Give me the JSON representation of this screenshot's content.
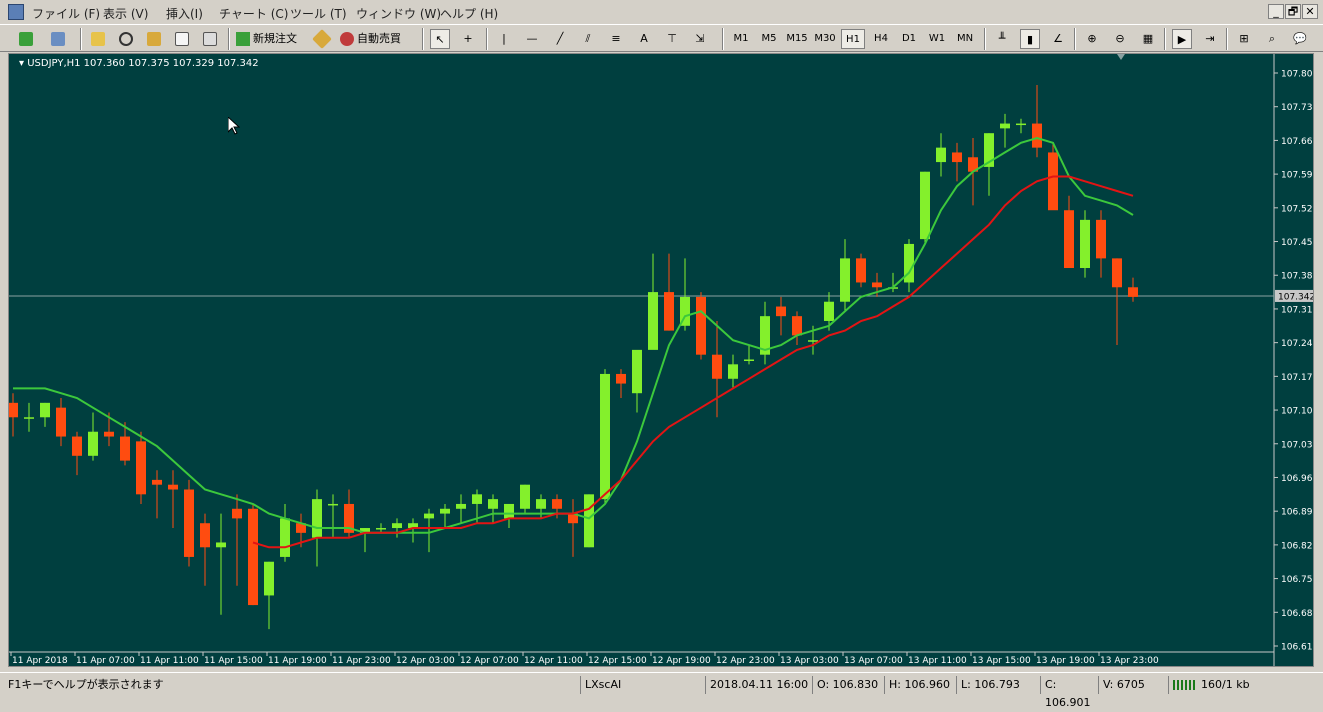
{
  "menu": {
    "items": [
      "ファイル (F)",
      "表示 (V)",
      "挿入(I)",
      "チャート (C)",
      "ツール (T)",
      "ウィンドウ (W)",
      "ヘルプ (H)"
    ],
    "window_controls": [
      "_",
      "🗗",
      "✕"
    ]
  },
  "toolbar": {
    "new_order_label": "新規注文",
    "auto_trade_label": "自動売買",
    "text_tool": "A",
    "timeframes": [
      "M1",
      "M5",
      "M15",
      "M30",
      "H1",
      "H4",
      "D1",
      "W1",
      "MN"
    ],
    "active_timeframe": "H1"
  },
  "chart": {
    "header": "USDJPY,H1  107.360 107.375 107.329 107.342",
    "current_price_label": "107.342",
    "colors": {
      "background": "#003f3f",
      "bull": "#84f02c",
      "bear": "#ff4c10",
      "ma_fast": "#3cc83c",
      "ma_slow": "#e31414",
      "price_line": "#8aa2a2"
    }
  },
  "chart_data": {
    "type": "candlestick",
    "symbol": "USDJPY",
    "timeframe": "H1",
    "header_ohlc": {
      "open": 107.36,
      "high": 107.375,
      "low": 107.329,
      "close": 107.342
    },
    "ylim": [
      106.615,
      107.805
    ],
    "y_ticks": [
      "107.805",
      "107.735",
      "107.665",
      "107.595",
      "107.525",
      "107.455",
      "107.385",
      "107.315",
      "107.245",
      "107.175",
      "107.105",
      "107.035",
      "106.965",
      "106.895",
      "106.825",
      "106.755",
      "106.685",
      "106.615"
    ],
    "x_ticks": [
      "11 Apr 2018",
      "11 Apr 07:00",
      "11 Apr 11:00",
      "11 Apr 15:00",
      "11 Apr 19:00",
      "11 Apr 23:00",
      "12 Apr 03:00",
      "12 Apr 07:00",
      "12 Apr 11:00",
      "12 Apr 15:00",
      "12 Apr 19:00",
      "12 Apr 23:00",
      "13 Apr 03:00",
      "13 Apr 07:00",
      "13 Apr 11:00",
      "13 Apr 15:00",
      "13 Apr 19:00",
      "13 Apr 23:00"
    ],
    "candles": [
      [
        107.12,
        107.14,
        107.05,
        107.09
      ],
      [
        107.09,
        107.12,
        107.06,
        107.09
      ],
      [
        107.09,
        107.12,
        107.07,
        107.12
      ],
      [
        107.11,
        107.13,
        107.03,
        107.05
      ],
      [
        107.05,
        107.06,
        106.97,
        107.01
      ],
      [
        107.01,
        107.1,
        107.0,
        107.06
      ],
      [
        107.06,
        107.1,
        107.03,
        107.05
      ],
      [
        107.05,
        107.08,
        106.99,
        107.0
      ],
      [
        107.04,
        107.06,
        106.91,
        106.93
      ],
      [
        106.96,
        106.98,
        106.88,
        106.95
      ],
      [
        106.95,
        106.98,
        106.86,
        106.94
      ],
      [
        106.94,
        106.96,
        106.78,
        106.8
      ],
      [
        106.87,
        106.89,
        106.74,
        106.82
      ],
      [
        106.82,
        106.89,
        106.68,
        106.83
      ],
      [
        106.9,
        106.93,
        106.74,
        106.88
      ],
      [
        106.9,
        106.91,
        106.7,
        106.7
      ],
      [
        106.72,
        106.79,
        106.65,
        106.79
      ],
      [
        106.8,
        106.91,
        106.79,
        106.88
      ],
      [
        106.87,
        106.89,
        106.82,
        106.85
      ],
      [
        106.84,
        106.94,
        106.78,
        106.92
      ],
      [
        106.91,
        106.93,
        106.84,
        106.91
      ],
      [
        106.91,
        106.94,
        106.84,
        106.85
      ],
      [
        106.85,
        106.86,
        106.81,
        106.86
      ],
      [
        106.86,
        106.87,
        106.85,
        106.86
      ],
      [
        106.86,
        106.88,
        106.84,
        106.87
      ],
      [
        106.86,
        106.88,
        106.83,
        106.87
      ],
      [
        106.88,
        106.9,
        106.81,
        106.89
      ],
      [
        106.89,
        106.91,
        106.86,
        106.9
      ],
      [
        106.9,
        106.93,
        106.87,
        106.91
      ],
      [
        106.91,
        106.94,
        106.87,
        106.93
      ],
      [
        106.9,
        106.93,
        106.87,
        106.92
      ],
      [
        106.88,
        106.91,
        106.86,
        106.91
      ],
      [
        106.9,
        106.95,
        106.89,
        106.95
      ],
      [
        106.9,
        106.93,
        106.88,
        106.92
      ],
      [
        106.92,
        106.93,
        106.88,
        106.9
      ],
      [
        106.89,
        106.92,
        106.8,
        106.87
      ],
      [
        106.82,
        106.93,
        106.82,
        106.93
      ],
      [
        106.92,
        107.19,
        106.91,
        107.18
      ],
      [
        107.18,
        107.19,
        107.13,
        107.16
      ],
      [
        107.14,
        107.22,
        107.1,
        107.23
      ],
      [
        107.23,
        107.43,
        107.24,
        107.35
      ],
      [
        107.35,
        107.43,
        107.27,
        107.27
      ],
      [
        107.28,
        107.42,
        107.27,
        107.34
      ],
      [
        107.34,
        107.35,
        107.21,
        107.22
      ],
      [
        107.22,
        107.29,
        107.09,
        107.17
      ],
      [
        107.17,
        107.22,
        107.15,
        107.2
      ],
      [
        107.21,
        107.24,
        107.2,
        107.21
      ],
      [
        107.22,
        107.33,
        107.2,
        107.3
      ],
      [
        107.32,
        107.34,
        107.26,
        107.3
      ],
      [
        107.3,
        107.31,
        107.24,
        107.26
      ],
      [
        107.25,
        107.28,
        107.22,
        107.25
      ],
      [
        107.29,
        107.35,
        107.27,
        107.33
      ],
      [
        107.33,
        107.46,
        107.31,
        107.42
      ],
      [
        107.42,
        107.43,
        107.36,
        107.37
      ],
      [
        107.37,
        107.39,
        107.34,
        107.36
      ],
      [
        107.36,
        107.39,
        107.35,
        107.36
      ],
      [
        107.37,
        107.46,
        107.35,
        107.45
      ],
      [
        107.46,
        107.6,
        107.45,
        107.6
      ],
      [
        107.62,
        107.68,
        107.59,
        107.65
      ],
      [
        107.64,
        107.66,
        107.58,
        107.62
      ],
      [
        107.63,
        107.67,
        107.53,
        107.6
      ],
      [
        107.61,
        107.68,
        107.55,
        107.68
      ],
      [
        107.69,
        107.72,
        107.65,
        107.7
      ],
      [
        107.7,
        107.71,
        107.68,
        107.7
      ],
      [
        107.7,
        107.78,
        107.63,
        107.65
      ],
      [
        107.64,
        107.66,
        107.55,
        107.52
      ],
      [
        107.52,
        107.55,
        107.4,
        107.4
      ],
      [
        107.4,
        107.52,
        107.38,
        107.5
      ],
      [
        107.5,
        107.52,
        107.38,
        107.42
      ],
      [
        107.42,
        107.42,
        107.24,
        107.36
      ],
      [
        107.36,
        107.38,
        107.33,
        107.34
      ]
    ],
    "series": [
      {
        "type": "ma",
        "values": [
          107.15,
          107.15,
          107.15,
          107.14,
          107.13,
          107.11,
          107.09,
          107.07,
          107.05,
          107.03,
          107.0,
          106.97,
          106.94,
          106.93,
          106.92,
          106.91,
          106.89,
          106.88,
          106.87,
          106.86,
          106.86,
          106.86,
          106.85,
          106.85,
          106.85,
          106.85,
          106.85,
          106.86,
          106.87,
          106.88,
          106.89,
          106.89,
          106.89,
          106.89,
          106.89,
          106.89,
          106.88,
          106.91,
          106.96,
          107.04,
          107.14,
          107.24,
          107.3,
          107.31,
          107.28,
          107.25,
          107.24,
          107.23,
          107.24,
          107.26,
          107.27,
          107.28,
          107.31,
          107.34,
          107.35,
          107.36,
          107.39,
          107.45,
          107.52,
          107.57,
          107.6,
          107.62,
          107.64,
          107.66,
          107.67,
          107.66,
          107.59,
          107.55,
          107.54,
          107.53,
          107.51
        ]
      },
      {
        "type": "ma",
        "values": [
          null,
          null,
          null,
          null,
          null,
          null,
          null,
          null,
          null,
          null,
          null,
          null,
          null,
          null,
          null,
          106.83,
          106.82,
          106.82,
          106.83,
          106.84,
          106.84,
          106.84,
          106.85,
          106.85,
          106.85,
          106.86,
          106.86,
          106.86,
          106.86,
          106.87,
          106.87,
          106.88,
          106.88,
          106.88,
          106.89,
          106.89,
          106.9,
          106.93,
          106.96,
          107.0,
          107.04,
          107.07,
          107.09,
          107.11,
          107.13,
          107.15,
          107.17,
          107.19,
          107.21,
          107.23,
          107.24,
          107.26,
          107.27,
          107.29,
          107.3,
          107.32,
          107.34,
          107.37,
          107.4,
          107.43,
          107.46,
          107.49,
          107.53,
          107.56,
          107.58,
          107.59,
          107.59,
          107.58,
          107.57,
          107.56,
          107.55
        ]
      }
    ]
  },
  "status": {
    "help_text": "F1キーでヘルプが表示されます",
    "profile": "LXscAI",
    "datetime": "2018.04.11 16:00",
    "open": "O: 106.830",
    "high": "H: 106.960",
    "low": "L: 106.793",
    "close": "C: 106.901",
    "volume": "V: 6705",
    "traffic": "160/1 kb"
  }
}
